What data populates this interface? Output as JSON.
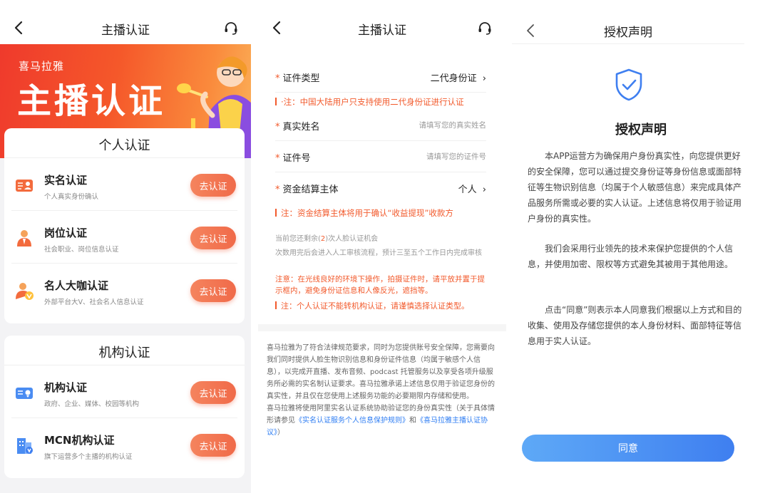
{
  "panel1": {
    "nav_title": "主播认证",
    "banner": {
      "brand": "喜马拉雅",
      "title": "主播认证"
    },
    "personal": {
      "heading": "个人认证",
      "items": [
        {
          "title": "实名认证",
          "desc": "个人真实身份确认",
          "button": "去认证",
          "icon": "id-card-icon"
        },
        {
          "title": "岗位认证",
          "desc": "社会职业、岗位信息认证",
          "button": "去认证",
          "icon": "job-person-icon"
        },
        {
          "title": "名人大咖认证",
          "desc": "外部平台大V、社会名人信息认证",
          "button": "去认证",
          "icon": "celebrity-v-icon"
        }
      ]
    },
    "organization": {
      "heading": "机构认证",
      "items": [
        {
          "title": "机构认证",
          "desc": "政府、企业、媒体、校园等机构",
          "button": "去认证",
          "icon": "org-card-icon"
        },
        {
          "title": "MCN机构认证",
          "desc": "旗下运营多个主播的机构认证",
          "button": "去认证",
          "icon": "mcn-building-icon"
        }
      ]
    }
  },
  "panel2": {
    "nav_title": "主播认证",
    "fields": {
      "doc_type": {
        "label": "证件类型",
        "value": "二代身份证"
      },
      "real_name": {
        "label": "真实姓名",
        "placeholder": "请填写您的真实姓名"
      },
      "doc_number": {
        "label": "证件号",
        "placeholder": "请填写您的证件号"
      },
      "settlement": {
        "label": "资金结算主体",
        "value": "个人"
      }
    },
    "note_doc_type": "·注：中国大陆用户只支持使用二代身份证进行认证",
    "note_settlement": "注：资金结算主体将用于确认“收益提现”收款方",
    "remaining_prefix": "当前您还剩余(",
    "remaining_count": "2",
    "remaining_suffix": ")次人脸认证机会",
    "remaining_desc": "次数用完后会进入人工审核流程，预计三至五个工作日内完成审核",
    "attention": "注意：在光线良好的环境下操作，拍摄证件时，请平放并置于提示框内，避免身份证信息和人像反光，遮挡等。",
    "note_no_switch": "注：个人认证不能转机构认证，请谨慎选择认证类型。",
    "legal_p1": "喜马拉雅为了符合法律规范要求，同时为您提供账号安全保障，您需要向我们同时提供人脸生物识别信息和身份证件信息（均属于敏感个人信息），以完成开直播、发布音频、podcast 托管服务以及享受各项升级服务所必需的实名制认证要求。喜马拉雅承诺上述信息仅用于验证您身份的真实性，并且仅在您使用上述服务功能的必要期限内存储和使用。",
    "legal_p2_prefix": "喜马拉雅将使用阿里实名认证系统协助验证您的身份真实性（关于具体情形请参见",
    "legal_link1": "《实名认证服务个人信息保护规则》",
    "legal_and": "和",
    "legal_link2": "《喜马拉雅主播认证协议》",
    "legal_p2_suffix": "）"
  },
  "panel3": {
    "nav_title": "授权声明",
    "heading": "授权声明",
    "paragraphs": [
      "本APP运营方为确保用户身份真实性，向您提供更好的安全保障，您可以通过提交身份证等身份信息或面部特征等生物识别信息（均属于个人敏感信息）来完成具体产品服务所需或必要的实人认证。上述信息将仅用于验证用户身份的真实性。",
      "我们会采用行业领先的技术来保护您提供的个人信息，并使用加密、限权等方式避免其被用于其他用途。",
      "点击“同意”则表示本人同意我们根据以上方式和目的收集、使用及存储您提供的本人身份材料、面部特征等信息用于实人认证。"
    ],
    "agree_button": "同意"
  },
  "colors": {
    "accent_orange": "#f25a2c",
    "link_blue": "#2f7ef3",
    "agree_blue": "#4a8cf2"
  }
}
